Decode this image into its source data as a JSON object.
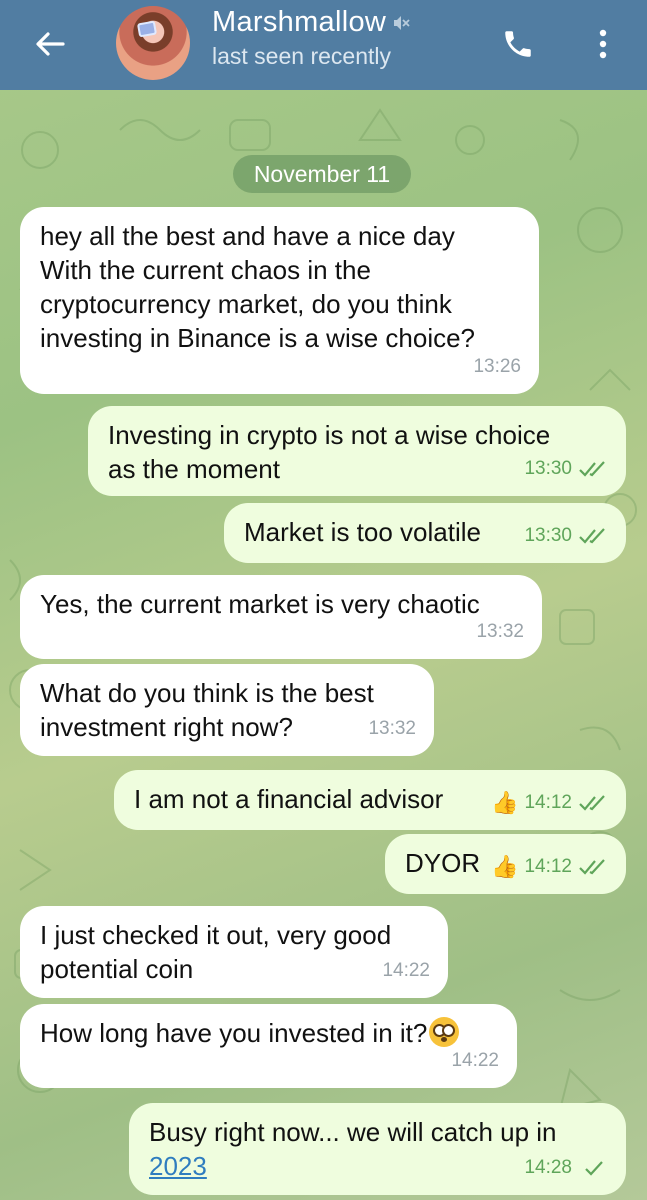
{
  "header": {
    "contact_name": "Marshmallow",
    "status": "last seen recently",
    "icons": [
      "arrow-left-icon",
      "muted-speaker-icon",
      "phone-icon",
      "more-vertical-icon"
    ],
    "bar_color": "#517da2"
  },
  "date_chip": "November 11",
  "messages": [
    {
      "dir": "in",
      "lines": [
        "hey all the best and have a nice day",
        "With the current chaos in the",
        "cryptocurrency market, do you think",
        "investing in Binance is a wise choice?"
      ],
      "time": "13:26"
    },
    {
      "dir": "out",
      "lines": [
        "Investing in crypto is not a wise choice",
        "as the moment"
      ],
      "time": "13:30",
      "read": true
    },
    {
      "dir": "out",
      "lines": [
        "Market is too volatile"
      ],
      "time": "13:30",
      "read": true
    },
    {
      "dir": "in",
      "lines": [
        "Yes, the current market is very chaotic"
      ],
      "time": "13:32"
    },
    {
      "dir": "in",
      "lines": [
        "What do you think is the best",
        "investment right now?"
      ],
      "time": "13:32"
    },
    {
      "dir": "out",
      "lines": [
        "I am not a financial advisor"
      ],
      "time": "14:12",
      "reaction": "👍",
      "read": true
    },
    {
      "dir": "out",
      "lines": [
        "DYOR"
      ],
      "time": "14:12",
      "reaction": "👍",
      "read": true
    },
    {
      "dir": "in",
      "lines": [
        "I just checked it out, very good",
        "potential coin"
      ],
      "time": "14:22"
    },
    {
      "dir": "in",
      "lines": [
        "How long have you invested in it?"
      ],
      "time": "14:22",
      "emoji": "flushed-face-emoji"
    },
    {
      "dir": "out",
      "lines": [
        "Busy right now... we will catch up in"
      ],
      "link": "2023",
      "time": "14:28",
      "read": false
    }
  ],
  "colors": {
    "incoming": "#ffffff",
    "outgoing": "#effdde",
    "outgoing_meta": "#5fa55a",
    "link": "#2f7dbf"
  }
}
